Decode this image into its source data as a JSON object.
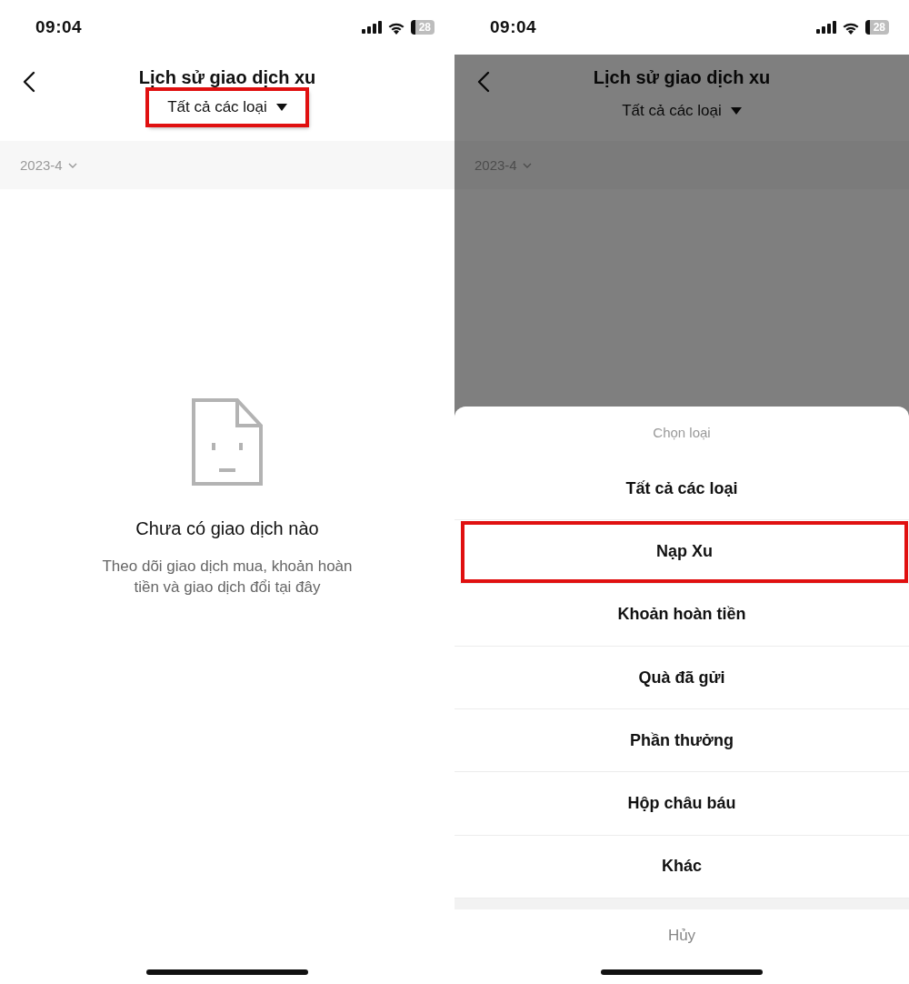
{
  "screens": [
    {
      "status_bar": {
        "time": "09:04",
        "battery": "28"
      },
      "header": {
        "title": "Lịch sử giao dịch xu",
        "filter": {
          "label": "Tất cả các loại",
          "highlighted": true
        }
      },
      "month": "2023-4",
      "empty_state": {
        "title": "Chưa có giao dịch nào",
        "message": "Theo dõi giao dịch mua, khoản hoàn tiền và giao dịch đổi tại đây"
      }
    },
    {
      "status_bar": {
        "time": "09:04",
        "battery": "28"
      },
      "header": {
        "title": "Lịch sử giao dịch xu",
        "filter": {
          "label": "Tất cả các loại",
          "highlighted": false
        }
      },
      "month": "2023-4",
      "dimmed": true,
      "sheet": {
        "title": "Chọn loại",
        "options": [
          {
            "label": "Tất cả các loại",
            "highlighted": false
          },
          {
            "label": "Nạp Xu",
            "highlighted": true
          },
          {
            "label": "Khoản hoàn tiền",
            "highlighted": false
          },
          {
            "label": "Quà đã gửi",
            "highlighted": false
          },
          {
            "label": "Phần thưởng",
            "highlighted": false
          },
          {
            "label": "Hộp châu báu",
            "highlighted": false
          },
          {
            "label": "Khác",
            "highlighted": false
          }
        ],
        "cancel": "Hủy"
      }
    }
  ]
}
